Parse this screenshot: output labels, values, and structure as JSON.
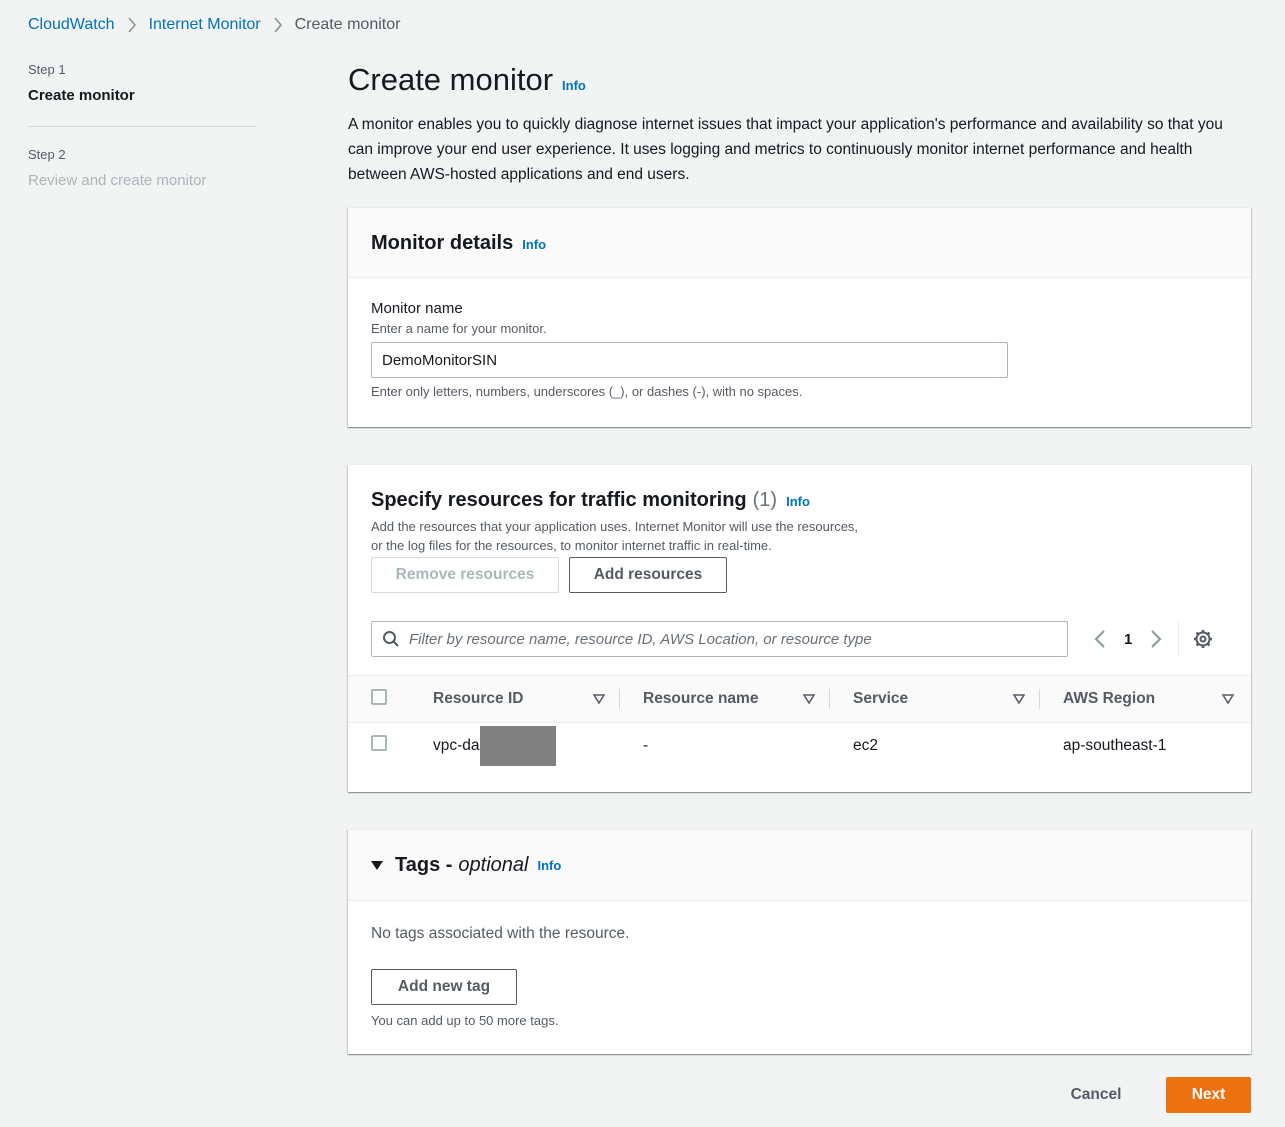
{
  "breadcrumb": {
    "items": [
      "CloudWatch",
      "Internet Monitor"
    ],
    "current": "Create monitor"
  },
  "steps": [
    {
      "label": "Step 1",
      "title": "Create monitor"
    },
    {
      "label": "Step 2",
      "title": "Review and create monitor"
    }
  ],
  "page": {
    "title": "Create monitor",
    "info": "Info",
    "description": "A monitor enables you to quickly diagnose internet issues that impact your application's performance and availability so that you can improve your end user experience. It uses logging and metrics to continuously monitor internet performance and health between AWS-hosted applications and end users."
  },
  "details": {
    "title": "Monitor details",
    "info": "Info",
    "name_label": "Monitor name",
    "name_description": "Enter a name for your monitor.",
    "name_value": "DemoMonitorSIN",
    "name_constraint": "Enter only letters, numbers, underscores (_), or dashes (-), with no spaces."
  },
  "resources": {
    "title": "Specify resources for traffic monitoring",
    "count": "(1)",
    "info": "Info",
    "description": "Add the resources that your application uses. Internet Monitor will use the resources, or the log files for the resources, to monitor internet traffic in real-time.",
    "remove_label": "Remove resources",
    "add_label": "Add resources",
    "filter_placeholder": "Filter by resource name, resource ID, AWS Location, or resource type",
    "page_number": "1",
    "columns": [
      "Resource ID",
      "Resource name",
      "Service",
      "AWS Region"
    ],
    "rows": [
      {
        "resource_id": "vpc-da",
        "resource_name": "-",
        "service": "ec2",
        "region": "ap-southeast-1"
      }
    ]
  },
  "tags": {
    "title": "Tags -",
    "optional": "optional",
    "info": "Info",
    "empty_text": "No tags associated with the resource.",
    "add_label": "Add new tag",
    "limit_text": "You can add up to 50 more tags."
  },
  "footer": {
    "cancel_label": "Cancel",
    "next_label": "Next"
  },
  "colors": {
    "link": "#0073bb",
    "primary": "#ec7211",
    "background": "#f2f3f3"
  }
}
